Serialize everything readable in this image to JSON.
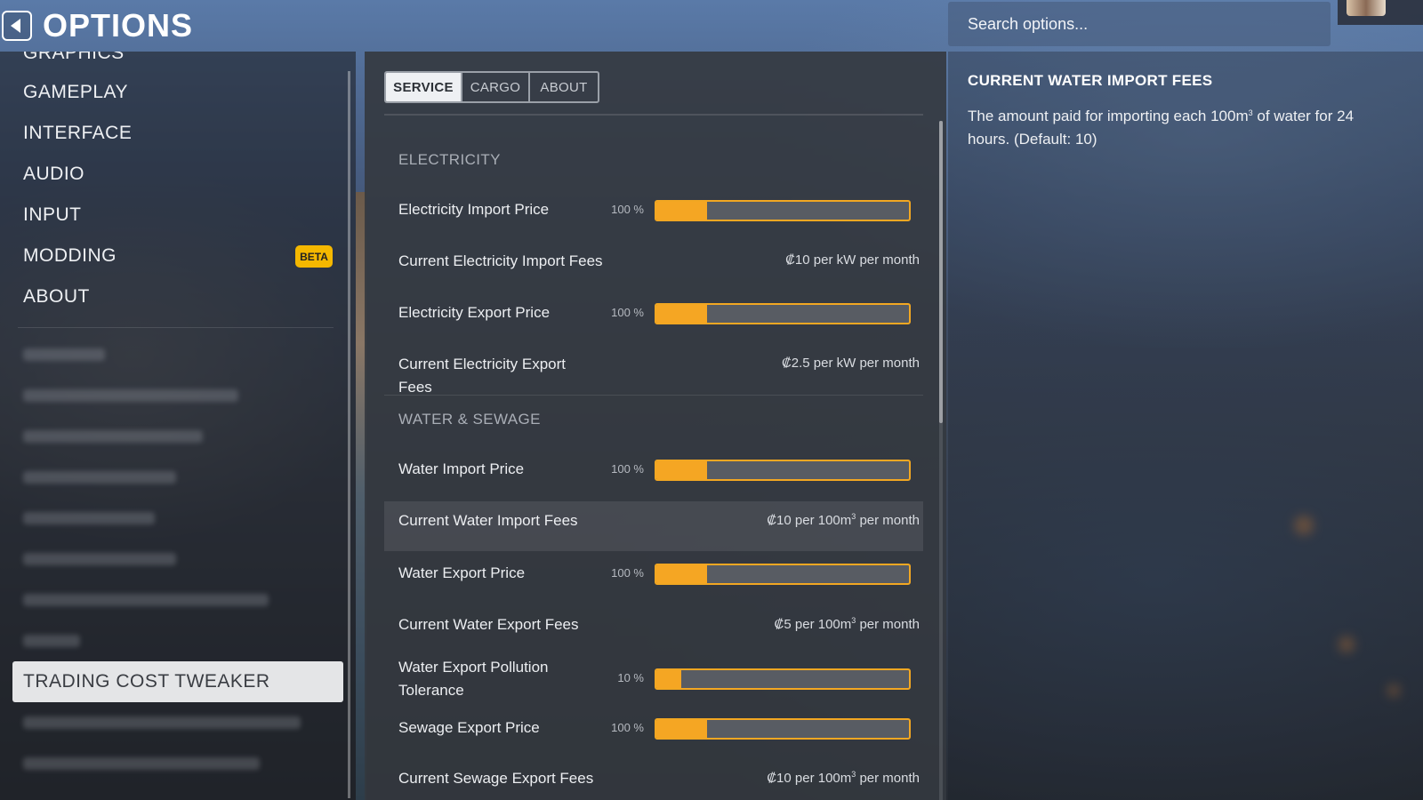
{
  "header": {
    "title": "OPTIONS",
    "back_icon": "back-arrow-icon",
    "search_placeholder": "Search options..."
  },
  "sidebar": {
    "items": [
      {
        "label": "GRAPHICS"
      },
      {
        "label": "GAMEPLAY"
      },
      {
        "label": "INTERFACE"
      },
      {
        "label": "AUDIO"
      },
      {
        "label": "INPUT"
      },
      {
        "label": "MODDING",
        "badge": "BETA"
      },
      {
        "label": "ABOUT"
      }
    ],
    "selected_mod": "TRADING COST TWEAKER"
  },
  "tabs": [
    "SERVICE",
    "CARGO",
    "ABOUT"
  ],
  "active_tab": "SERVICE",
  "sections": {
    "electricity": {
      "title": "ELECTRICITY",
      "import_price": {
        "label": "Electricity Import Price",
        "percent": "100 %",
        "fill_fraction": 0.2
      },
      "import_fees": {
        "label": "Current Electricity Import Fees",
        "value": "₡10 per kW per month"
      },
      "export_price": {
        "label": "Electricity Export Price",
        "percent": "100 %",
        "fill_fraction": 0.2
      },
      "export_fees": {
        "label": "Current Electricity Export Fees",
        "value": "₡2.5 per kW per month"
      }
    },
    "water": {
      "title": "WATER & SEWAGE",
      "import_price": {
        "label": "Water Import Price",
        "percent": "100 %",
        "fill_fraction": 0.2
      },
      "import_fees": {
        "label": "Current Water Import Fees",
        "value_prefix": "₡10 per 100m",
        "value_suffix": " per month"
      },
      "export_price": {
        "label": "Water Export Price",
        "percent": "100 %",
        "fill_fraction": 0.2
      },
      "export_fees": {
        "label": "Current Water Export Fees",
        "value_prefix": "₡5 per 100m",
        "value_suffix": " per month"
      },
      "pollution": {
        "label": "Water Export Pollution Tolerance",
        "percent": "10 %",
        "fill_fraction": 0.1
      },
      "sewage_price": {
        "label": "Sewage Export Price",
        "percent": "100 %",
        "fill_fraction": 0.2
      },
      "sewage_fees": {
        "label": "Current Sewage Export Fees",
        "value_prefix": "₡10 per 100m",
        "value_suffix": " per month"
      }
    }
  },
  "description": {
    "title": "CURRENT WATER IMPORT FEES",
    "text_before": "The amount paid for importing each 100m",
    "sup": "3",
    "text_after": " of water for 24 hours. (Default: 10)"
  },
  "colors": {
    "accent": "#f5a623",
    "badge": "#f5b800"
  }
}
